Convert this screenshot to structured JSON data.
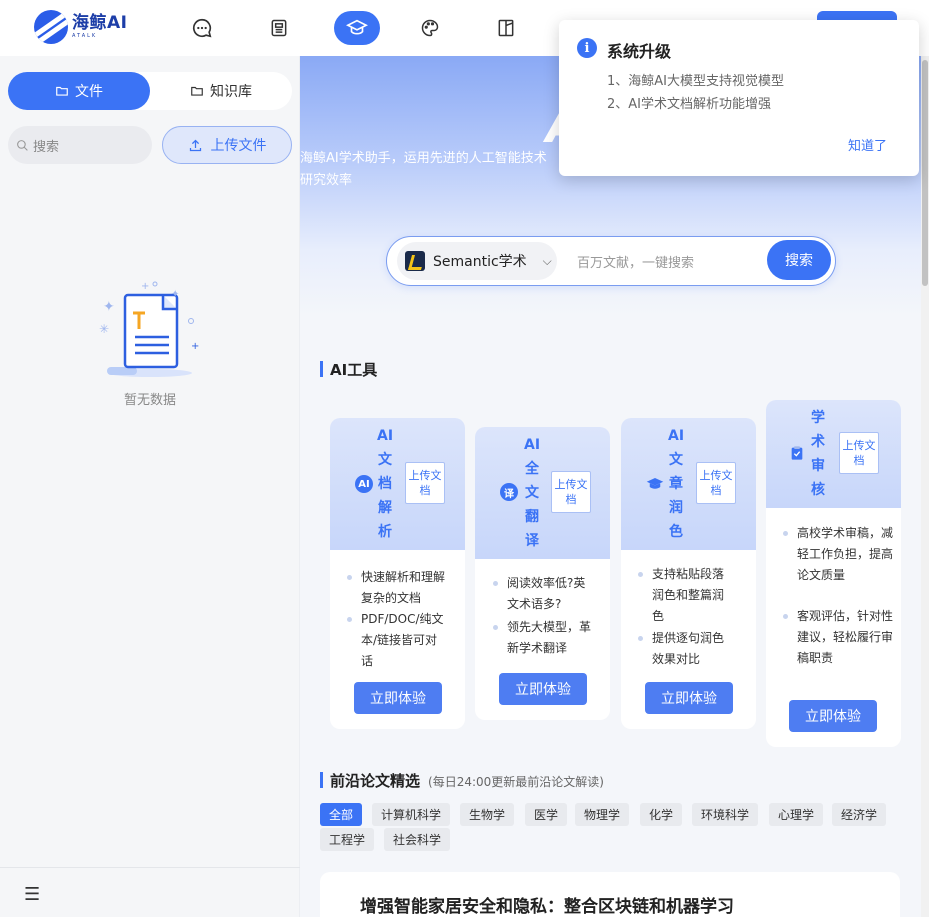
{
  "app": {
    "logo_text": "海鲸AI",
    "logo_sub": "ATALK"
  },
  "nav": {
    "icons": [
      "chat-icon",
      "document-icon",
      "graduation-cap-icon",
      "palette-icon",
      "book-icon"
    ]
  },
  "sidebar": {
    "tab_files": "文件",
    "tab_kb": "知识库",
    "search_placeholder": "搜索",
    "upload_label": "上传文件",
    "empty_text": "暂无数据"
  },
  "hero": {
    "desc_line1": "海鲸AI学术助手，运用先进的人工智能技术",
    "desc_line2": "研究效率",
    "big_text": "A"
  },
  "search": {
    "source": "Semantic学术",
    "placeholder": "百万文献，一键搜索",
    "button": "搜索"
  },
  "tools": {
    "title": "AI工具",
    "cards": [
      {
        "title": [
          "AI",
          "文",
          "档",
          "解",
          "析"
        ],
        "icon": "AI",
        "tag": "上传文档",
        "features": [
          "快速解析和理解复杂的文档",
          "PDF/DOC/纯文本/链接皆可对话"
        ],
        "button": "立即体验"
      },
      {
        "title": [
          "AI",
          "全",
          "文",
          "翻",
          "译"
        ],
        "icon": "译",
        "tag": "上传文档",
        "features": [
          "阅读效率低?英文术语多?",
          "领先大模型，革新学术翻译"
        ],
        "button": "立即体验"
      },
      {
        "title": [
          "AI",
          "文",
          "章",
          "润",
          "色"
        ],
        "icon": "hat",
        "tag": "上传文档",
        "features": [
          "支持粘贴段落润色和整篇润色",
          "提供逐句润色效果对比"
        ],
        "button": "立即体验"
      },
      {
        "title": [
          "学",
          "术",
          "审",
          "核"
        ],
        "icon": "clip",
        "tag": "上传文档",
        "features": [
          "高校学术审稿，减轻工作负担，提高论文质量",
          "客观评估，针对性建议，轻松履行审稿职责"
        ],
        "button": "立即体验"
      }
    ]
  },
  "papers": {
    "title": "前沿论文精选",
    "subtitle": "(每日24:00更新最前沿论文解读)",
    "categories": [
      "全部",
      "计算机科学",
      "生物学",
      "医学",
      "物理学",
      "化学",
      "环境科学",
      "心理学",
      "经济学",
      "工程学",
      "社会科学"
    ],
    "first_title": "增强智能家居安全和隐私：整合区块链和机器学习"
  },
  "popup": {
    "title": "系统升级",
    "line1": "1、海鲸AI大模型支持视觉模型",
    "line2": "2、AI学术文档解析功能增强",
    "ok": "知道了"
  },
  "colors": {
    "accent": "#3b73f5",
    "sidebar_bg": "#f5f6f8",
    "main_bg": "#f4f6fa"
  }
}
